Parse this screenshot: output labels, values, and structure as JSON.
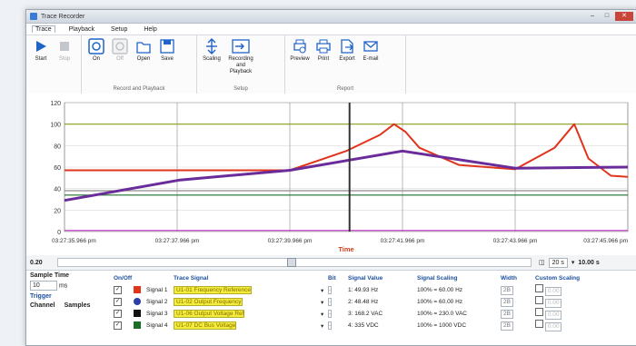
{
  "window": {
    "title": "Trace Recorder"
  },
  "menu": [
    "Trace",
    "Playback",
    "Setup",
    "Help"
  ],
  "ribbon": {
    "groups": [
      {
        "label": "",
        "buttons": [
          {
            "label": "Start",
            "icon": "play-icon"
          },
          {
            "label": "Stop",
            "icon": "stop-icon",
            "disabled": true
          }
        ]
      },
      {
        "label": "Record and Playback",
        "buttons": [
          {
            "label": "On",
            "icon": "record-on-icon"
          },
          {
            "label": "Off",
            "icon": "record-off-icon",
            "disabled": true
          },
          {
            "label": "Open",
            "icon": "folder-open-icon"
          },
          {
            "label": "Save",
            "icon": "save-icon"
          }
        ]
      },
      {
        "label": "Setup",
        "buttons": [
          {
            "label": "Scaling",
            "icon": "scaling-icon"
          },
          {
            "label": "Recording and Playback",
            "icon": "recording-playback-icon"
          }
        ]
      },
      {
        "label": "Report",
        "buttons": [
          {
            "label": "Preview",
            "icon": "print-preview-icon"
          },
          {
            "label": "Print",
            "icon": "print-icon"
          },
          {
            "label": "Export",
            "icon": "export-icon"
          },
          {
            "label": "E-mail",
            "icon": "email-icon"
          }
        ]
      }
    ]
  },
  "chart_data": {
    "type": "line",
    "xlabel": "Time",
    "ylabel": "",
    "ylim": [
      0,
      120
    ],
    "yticks": [
      0,
      20,
      40,
      60,
      80,
      100,
      120
    ],
    "xticks": [
      "03:27:35.966 pm",
      "03:27:37.966 pm",
      "03:27:39.966 pm",
      "03:27:41.966 pm",
      "03:27:43.966 pm",
      "03:27:45.966 pm"
    ],
    "xlim": [
      0,
      10
    ],
    "cursor_x": 5.06,
    "grid": true,
    "colors": {
      "olive": "#8a9a1a",
      "red": "#e0341c",
      "purple": "#6a2c9a",
      "green": "#1b6e2a",
      "magenta": "#c12ec9",
      "gray": "#8c8c8c"
    },
    "series": [
      {
        "color": "#8a9a1a",
        "x": [
          0,
          10
        ],
        "y": [
          100,
          100
        ]
      },
      {
        "color": "#8c8c8c",
        "x": [
          0,
          10
        ],
        "y": [
          38,
          38
        ]
      },
      {
        "color": "#1b6e2a",
        "x": [
          0,
          10
        ],
        "y": [
          34,
          34
        ]
      },
      {
        "color": "#c12ec9",
        "x": [
          0,
          10
        ],
        "y": [
          1,
          1
        ]
      },
      {
        "color": "#e0341c",
        "x": [
          0,
          4.0,
          5.0,
          5.6,
          5.85,
          6.05,
          6.3,
          7.0,
          8.0,
          8.7,
          9.05,
          9.3,
          9.7,
          10.0
        ],
        "y": [
          57,
          57,
          75,
          90,
          100,
          93,
          78,
          62,
          58,
          78,
          100,
          68,
          52,
          51
        ]
      },
      {
        "color": "#6a2c9a",
        "x": [
          0,
          2.05,
          4.0,
          6.0,
          8.0,
          10.0
        ],
        "y": [
          29,
          48,
          57,
          75,
          59,
          60
        ]
      }
    ]
  },
  "slider": {
    "value": "0.20",
    "zoom": "20 s",
    "time": "10.00 s"
  },
  "left_panel": {
    "sample_time_label": "Sample Time",
    "sample_time_value": "10",
    "sample_time_unit": "ms",
    "trigger_label": "Trigger",
    "channel_label": "Channel",
    "samples_label": "Samples"
  },
  "table": {
    "headers": [
      "On/Off",
      "Trace Signal",
      "Bit",
      "Signal Value",
      "Signal Scaling",
      "Width",
      "Custom Scaling"
    ],
    "rows": [
      {
        "name": "Signal 1",
        "color": "#e0341c",
        "signal": "U1-01 Frequency Reference",
        "bit": "-",
        "value": "1: 49.93 Hz",
        "scaling": "100% = 60.00 Hz",
        "width": "2B",
        "custom": "0.00"
      },
      {
        "name": "Signal 2",
        "color": "#2b3fa5",
        "signal": "U1-02 Output Frequency",
        "bit": "-",
        "value": "2: 48.48 Hz",
        "scaling": "100% = 60.00 Hz",
        "width": "2B",
        "custom": "0.00"
      },
      {
        "name": "Signal 3",
        "color": "#111111",
        "signal": "U1-06 Output Voltage Ref",
        "bit": "-",
        "value": "3: 168.2 VAC",
        "scaling": "100% = 230.0 VAC",
        "width": "2B",
        "custom": "0.00"
      },
      {
        "name": "Signal 4",
        "color": "#1b6e2a",
        "signal": "U1-07 DC Bus Voltage",
        "bit": "-",
        "value": "4: 335 VDC",
        "scaling": "100% = 1000 VDC",
        "width": "2B",
        "custom": "0.00"
      }
    ]
  }
}
